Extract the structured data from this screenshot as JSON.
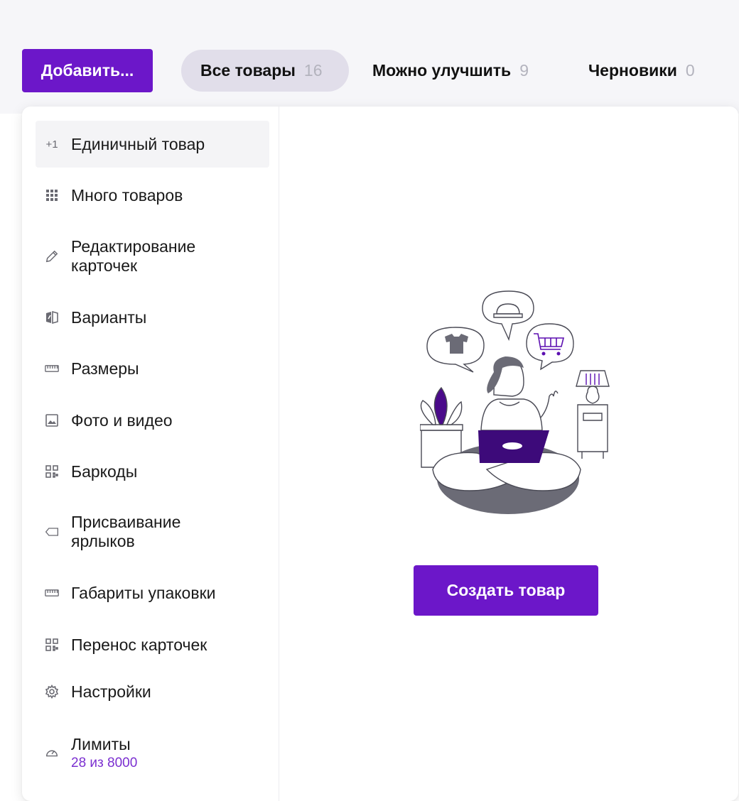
{
  "header": {
    "add_button": "Добавить...",
    "tabs": [
      {
        "label": "Все товары",
        "count": "16"
      },
      {
        "label": "Можно улучшить",
        "count": "9"
      },
      {
        "label": "Черновики",
        "count": "0"
      }
    ]
  },
  "menu": {
    "items": [
      {
        "label": "Единичный товар",
        "icon": "plus-one-icon",
        "icon_text": "+1"
      },
      {
        "label": "Много товаров",
        "icon": "grid-icon"
      },
      {
        "label": "Редактирование карточек",
        "icon": "pencil-icon"
      },
      {
        "label": "Варианты",
        "icon": "variants-icon"
      },
      {
        "label": "Размеры",
        "icon": "ruler-icon"
      },
      {
        "label": "Фото и видео",
        "icon": "image-icon"
      },
      {
        "label": "Баркоды",
        "icon": "qr-code-icon"
      },
      {
        "label": "Присваивание ярлыков",
        "icon": "tag-icon"
      },
      {
        "label": "Габариты упаковки",
        "icon": "ruler-icon"
      },
      {
        "label": "Перенос карточек",
        "icon": "qr-code-icon"
      },
      {
        "label": "Настройки",
        "icon": "gear-icon"
      },
      {
        "label": "Лимиты",
        "icon": "speedometer-icon",
        "sub": "28 из 8000"
      }
    ]
  },
  "content": {
    "create_button": "Создать товар"
  },
  "colors": {
    "accent": "#6c17c9",
    "limit_text": "#7b2fd0"
  }
}
